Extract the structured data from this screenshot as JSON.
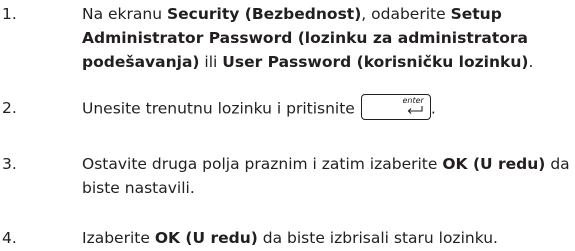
{
  "steps": [
    {
      "number": "1.",
      "t1": "Na ekranu ",
      "b1": "Security (Bezbednost)",
      "t2": ", odaberite ",
      "b2a": "Setup",
      "b2b": "Administrator Password (lozinku za administratora",
      "b2c": "podešavanja)",
      "t3": " ili ",
      "b3": "User Password (korisničku lozinku)",
      "t4": "."
    },
    {
      "number": "2.",
      "t1": "Unesite trenutnu lozinku i pritisnite",
      "key_label": "enter",
      "key_icon": "enter-arrow-icon",
      "t2": "."
    },
    {
      "number": "3.",
      "t1": "Ostavite druga polja praznim i zatim izaberite ",
      "b1": "OK (U redu)",
      "t2": " da",
      "t3": "biste nastavili."
    },
    {
      "number": "4.",
      "t1": "Izaberite ",
      "b1": "OK (U redu)",
      "t2": " da biste izbrisali staru lozinku."
    }
  ]
}
